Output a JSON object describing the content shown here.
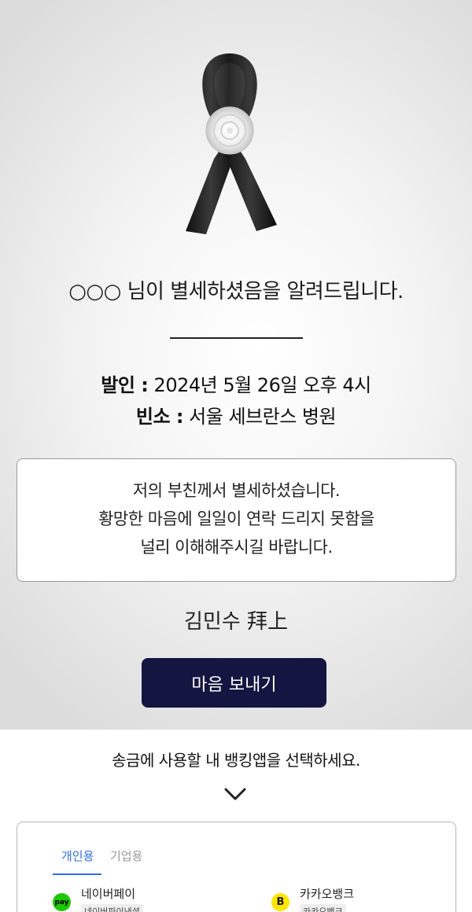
{
  "notice": {
    "headline": "○○○ 님이 별세하셨음을 알려드립니다.",
    "departure_key": "발인 :",
    "departure_value": "2024년 5월 26일 오후 4시",
    "venue_key": "빈소 :",
    "venue_value": "서울 세브란스 병원"
  },
  "message": {
    "line1": "저의 부친께서 별세하셨습니다.",
    "line2": "황망한 마음에 일일이 연락 드리지 못함을",
    "line3": "널리 이해해주시길 바랍니다."
  },
  "signature": "김민수 拜上",
  "send_button_label": "마음 보내기",
  "bank_prompt": "송금에 사용할 내 뱅킹앱을 선택하세요.",
  "tabs": [
    {
      "label": "개인용",
      "active": true
    },
    {
      "label": "기업용",
      "active": false
    }
  ],
  "banks": [
    {
      "name": "네이버페이",
      "tag": "네이버파이낸셜",
      "logo_text": "pay",
      "icon": "naverpay-icon",
      "color": "#1ec800"
    },
    {
      "name": "카카오뱅크",
      "tag": "카카오뱅크",
      "logo_text": "B",
      "icon": "kakaobank-icon",
      "color": "#ffe500"
    }
  ],
  "colors": {
    "button_bg": "#141541",
    "tab_active": "#2f6fe0"
  },
  "icons": {
    "ribbon": "mourning-ribbon-icon",
    "chevron": "chevron-down-icon"
  }
}
